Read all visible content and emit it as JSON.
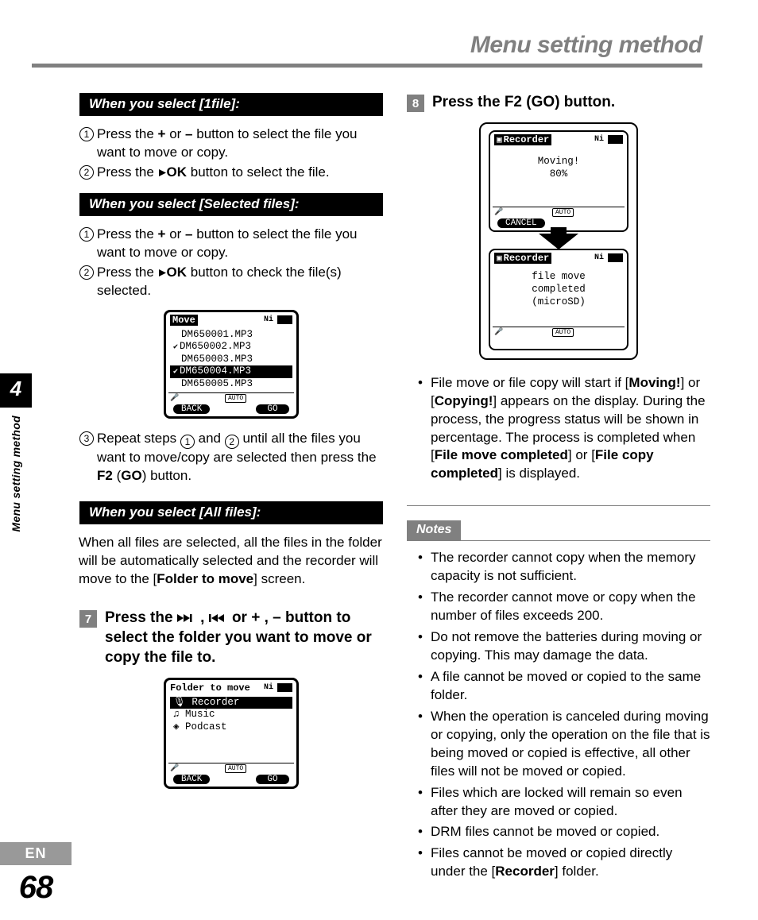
{
  "header": {
    "title": "Menu setting method"
  },
  "tab": {
    "chapter": "4",
    "side": "Menu setting method"
  },
  "footer": {
    "lang": "EN",
    "page": "68"
  },
  "left": {
    "bar1": "When you select [1file]:",
    "s1a_pre": "Press the ",
    "s1a_b1": "+",
    "s1a_mid": " or ",
    "s1a_b2": "–",
    "s1a_post": " button to select the file you want to move or copy.",
    "s1b_pre": "Press the ",
    "s1b_b": "OK",
    "s1b_post": " button to select the file.",
    "bar2": "When you select [Selected files]:",
    "s2a_pre": "Press the ",
    "s2a_b1": "+",
    "s2a_mid": " or ",
    "s2a_b2": "–",
    "s2a_post": " button to select the file you want to move or copy.",
    "s2b_pre": "Press the ",
    "s2b_b": "OK",
    "s2b_post": " button to check the file(s) selected.",
    "lcd_move": {
      "title": "Move",
      "rows": [
        "DM650001.MP3",
        "DM650002.MP3",
        "DM650003.MP3",
        "DM650004.MP3",
        "DM650005.MP3"
      ],
      "back": "BACK",
      "go": "GO",
      "auto": "AUTO"
    },
    "s2c_pre": "Repeat steps ",
    "s2c_mid1": " and ",
    "s2c_mid2": " until all the files you want to move/copy are selected then press the ",
    "s2c_b1": "F2",
    "s2c_paren_open": " (",
    "s2c_b2": "GO",
    "s2c_paren_close": ") button.",
    "bar3": "When you select [All files]:",
    "p3_pre": "When all files are selected, all the files in the folder will be automatically selected and the recorder will move to the [",
    "p3_b": "Folder to move",
    "p3_post": "] screen.",
    "step7": {
      "num": "7",
      "h_pre": "Press the ",
      "h_mid": " or + , – button to select the folder you want to move or copy the file to."
    },
    "lcd_folder": {
      "title": "Folder to move",
      "rows": [
        "Recorder",
        "Music",
        "Podcast"
      ],
      "back": "BACK",
      "go": "GO",
      "auto": "AUTO"
    }
  },
  "right": {
    "step8": {
      "num": "8",
      "h_pre": "Press the ",
      "h_b1": "F2",
      "h_paren": " (",
      "h_b2": "GO",
      "h_post": ") button."
    },
    "lcd_moving": {
      "title": "Recorder",
      "line1": "Moving!",
      "line2": "80%",
      "cancel": "CANCEL",
      "auto": "AUTO"
    },
    "lcd_done": {
      "title": "Recorder",
      "line1": "file move",
      "line2": "completed",
      "line3": "(microSD)",
      "auto": "AUTO"
    },
    "bullet_pre": "File move or file copy will start if [",
    "bullet_b1": "Moving!",
    "bullet_mid1": "] or [",
    "bullet_b2": "Copying!",
    "bullet_mid2": "] appears on the display. During the process, the progress status will be shown in percentage. The process is completed when [",
    "bullet_b3": "File move completed",
    "bullet_mid3": "] or [",
    "bullet_b4": "File copy completed",
    "bullet_post": "] is displayed.",
    "notes_label": "Notes",
    "notes": [
      "The recorder cannot copy when the memory capacity is not sufficient.",
      "The recorder cannot move or copy when the number of files exceeds 200.",
      "Do not remove the batteries during moving or copying. This may damage the data.",
      "A file cannot be moved or copied to the same folder.",
      "When the operation is canceled during moving or copying, only the operation on the file that is being moved or copied is effective, all other files will not be moved or copied.",
      "Files which are locked will remain so even after they are moved or copied.",
      "DRM files cannot be moved or copied."
    ],
    "note_last_pre": "Files cannot be moved or copied directly under the [",
    "note_last_b": "Recorder",
    "note_last_post": "] folder."
  }
}
